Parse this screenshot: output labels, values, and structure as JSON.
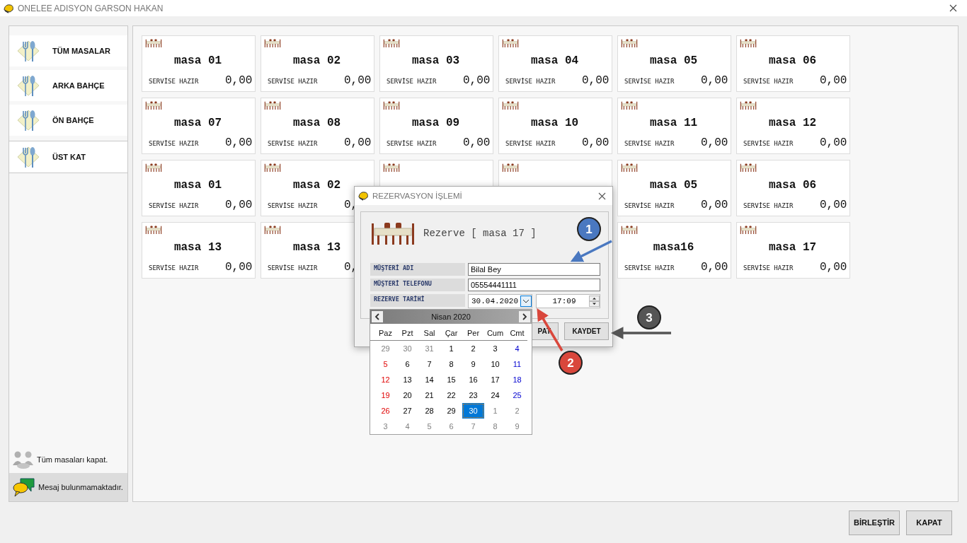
{
  "window": {
    "title": "ONELEE ADISYON GARSON HAKAN"
  },
  "sidebar": {
    "items": [
      {
        "label": "TÜM MASALAR",
        "selected": false
      },
      {
        "label": "ARKA BAHÇE",
        "selected": false
      },
      {
        "label": "ÖN BAHÇE",
        "selected": false
      },
      {
        "label": "ÜST KAT",
        "selected": true
      }
    ],
    "close_all": "Tüm masaları kapat.",
    "message": "Mesaj bulunmamaktadır."
  },
  "tables": [
    {
      "name": "masa 01",
      "status": "SERVİSE HAZIR",
      "value": "0,00"
    },
    {
      "name": "masa 02",
      "status": "SERVİSE HAZIR",
      "value": "0,00"
    },
    {
      "name": "masa 03",
      "status": "SERVİSE HAZIR",
      "value": "0,00"
    },
    {
      "name": "masa 04",
      "status": "SERVİSE HAZIR",
      "value": "0,00"
    },
    {
      "name": "masa 05",
      "status": "SERVİSE HAZIR",
      "value": "0,00"
    },
    {
      "name": "masa 06",
      "status": "SERVİSE HAZIR",
      "value": "0,00"
    },
    {
      "name": "masa 07",
      "status": "SERVİSE HAZIR",
      "value": "0,00"
    },
    {
      "name": "masa 08",
      "status": "SERVİSE HAZIR",
      "value": "0,00"
    },
    {
      "name": "masa 09",
      "status": "SERVİSE HAZIR",
      "value": "0,00"
    },
    {
      "name": "masa 10",
      "status": "SERVİSE HAZIR",
      "value": "0,00"
    },
    {
      "name": "masa 11",
      "status": "SERVİSE HAZIR",
      "value": "0,00"
    },
    {
      "name": "masa 12",
      "status": "SERVİSE HAZIR",
      "value": "0,00"
    },
    {
      "name": "masa 01",
      "status": "SERVİSE HAZIR",
      "value": "0,00"
    },
    {
      "kind": "covered",
      "name": "masa 02",
      "status": "SERVİSE HAZIR",
      "value": "0,"
    },
    {
      "kind": "covered"
    },
    {
      "kind": "covered"
    },
    {
      "name": "masa 05",
      "status": "SERVİSE HAZIR",
      "value": "0,00"
    },
    {
      "name": "masa 06",
      "status": "SERVİSE HAZIR",
      "value": "0,00"
    },
    {
      "name": "masa 13",
      "status": "SERVİSE HAZIR",
      "value": "0,00"
    },
    {
      "kind": "covered",
      "name": "masa 13",
      "status": "SERVİSE HAZIR",
      "value": "0,"
    },
    {
      "name": "masa16",
      "status": "SERVİSE HAZIR",
      "value": "0,00"
    },
    {
      "name": "masa 17",
      "status": "SERVİSE HAZIR",
      "value": "0,00"
    }
  ],
  "footer_buttons": [
    "BİRLEŞTİR",
    "KAPAT"
  ],
  "dialog": {
    "title": "REZERVASYON İŞLEMİ",
    "heading": "Rezerve [ masa 17 ]",
    "fields": [
      {
        "kind": "text",
        "label": "MÜŞTERİ ADI",
        "value": "Bilal Bey"
      },
      {
        "kind": "text",
        "label": "MÜŞTERİ TELEFONU",
        "value": "05554441111"
      },
      {
        "kind": "datetime",
        "label": "REZERVE TARİHİ",
        "value": "30.04.2020",
        "time": "17:09"
      }
    ],
    "buttons": [
      {
        "label": "PAT"
      },
      {
        "label": "KAYDET"
      }
    ]
  },
  "calendar": {
    "month": "Nisan 2020",
    "weekdays": [
      "Paz",
      "Pzt",
      "Sal",
      "Çar",
      "Per",
      "Cum",
      "Cmt"
    ],
    "weeks": [
      [
        {
          "day": "29",
          "kind": "muted",
          "selected": false
        },
        {
          "day": "30",
          "kind": "muted",
          "selected": false
        },
        {
          "day": "31",
          "kind": "muted",
          "selected": false
        },
        {
          "day": "1",
          "kind": "weekday",
          "selected": false
        },
        {
          "day": "2",
          "kind": "weekday",
          "selected": false
        },
        {
          "day": "3",
          "kind": "weekday",
          "selected": false
        },
        {
          "day": "4",
          "kind": "saturday",
          "selected": false
        }
      ],
      [
        {
          "day": "5",
          "kind": "sunday",
          "selected": false
        },
        {
          "day": "6",
          "kind": "weekday",
          "selected": false
        },
        {
          "day": "7",
          "kind": "weekday",
          "selected": false
        },
        {
          "day": "8",
          "kind": "weekday",
          "selected": false
        },
        {
          "day": "9",
          "kind": "weekday",
          "selected": false
        },
        {
          "day": "10",
          "kind": "weekday",
          "selected": false
        },
        {
          "day": "11",
          "kind": "saturday",
          "selected": false
        }
      ],
      [
        {
          "day": "12",
          "kind": "sunday",
          "selected": false
        },
        {
          "day": "13",
          "kind": "weekday",
          "selected": false
        },
        {
          "day": "14",
          "kind": "weekday",
          "selected": false
        },
        {
          "day": "15",
          "kind": "weekday",
          "selected": false
        },
        {
          "day": "16",
          "kind": "weekday",
          "selected": false
        },
        {
          "day": "17",
          "kind": "weekday",
          "selected": false
        },
        {
          "day": "18",
          "kind": "saturday",
          "selected": false
        }
      ],
      [
        {
          "day": "19",
          "kind": "sunday",
          "selected": false
        },
        {
          "day": "20",
          "kind": "weekday",
          "selected": false
        },
        {
          "day": "21",
          "kind": "weekday",
          "selected": false
        },
        {
          "day": "22",
          "kind": "weekday",
          "selected": false
        },
        {
          "day": "23",
          "kind": "weekday",
          "selected": false
        },
        {
          "day": "24",
          "kind": "weekday",
          "selected": false
        },
        {
          "day": "25",
          "kind": "saturday",
          "selected": false
        }
      ],
      [
        {
          "day": "26",
          "kind": "sunday",
          "selected": false
        },
        {
          "day": "27",
          "kind": "weekday",
          "selected": false
        },
        {
          "day": "28",
          "kind": "weekday",
          "selected": false
        },
        {
          "day": "29",
          "kind": "weekday",
          "selected": false
        },
        {
          "day": "30",
          "kind": "weekday",
          "selected": true
        },
        {
          "day": "1",
          "kind": "muted",
          "selected": false
        },
        {
          "day": "2",
          "kind": "muted",
          "selected": false
        }
      ],
      [
        {
          "day": "3",
          "kind": "muted",
          "selected": false
        },
        {
          "day": "4",
          "kind": "muted",
          "selected": false
        },
        {
          "day": "5",
          "kind": "muted",
          "selected": false
        },
        {
          "day": "6",
          "kind": "muted",
          "selected": false
        },
        {
          "day": "7",
          "kind": "muted",
          "selected": false
        },
        {
          "day": "8",
          "kind": "muted",
          "selected": false
        },
        {
          "day": "9",
          "kind": "muted",
          "selected": false
        }
      ]
    ]
  },
  "annotations": [
    {
      "number": "1",
      "color": "#4a78c0"
    },
    {
      "number": "2",
      "color": "#d9473c"
    },
    {
      "number": "3",
      "color": "#555555"
    }
  ]
}
